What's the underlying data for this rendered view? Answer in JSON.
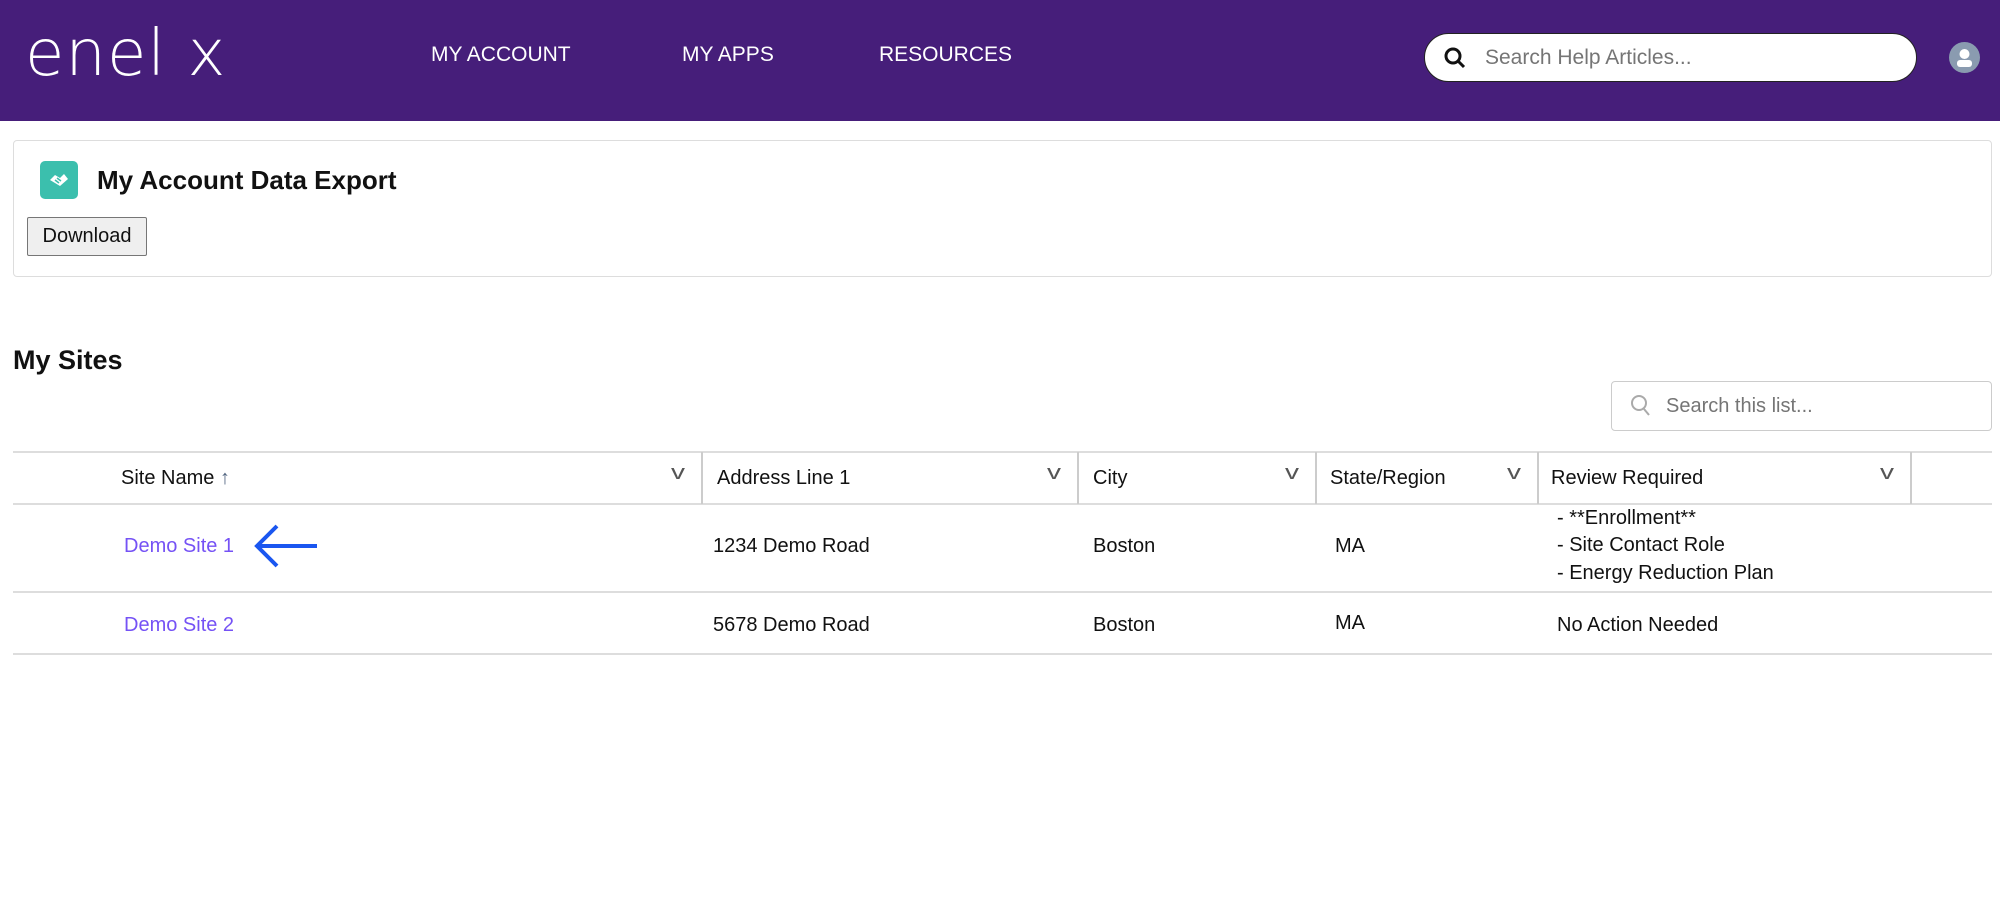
{
  "header": {
    "logo": "enel x",
    "nav": [
      "MY ACCOUNT",
      "MY APPS",
      "RESOURCES"
    ],
    "search_placeholder": "Search Help Articles..."
  },
  "export_card": {
    "title": "My Account Data Export",
    "download_label": "Download"
  },
  "sites": {
    "title": "My Sites",
    "search_placeholder": "Search this list...",
    "columns": [
      "Site Name",
      "Address Line 1",
      "City",
      "State/Region",
      "Review Required"
    ],
    "sort_indicator": "↑",
    "rows": [
      {
        "name": "Demo Site 1",
        "address": "1234 Demo Road",
        "city": "Boston",
        "state": "MA",
        "review": [
          "- **Enrollment**",
          "- Site Contact Role",
          "- Energy Reduction Plan"
        ]
      },
      {
        "name": "Demo Site 2",
        "address": "5678 Demo Road",
        "city": "Boston",
        "state": "MA",
        "review": [
          "No Action Needed"
        ]
      }
    ]
  },
  "colors": {
    "header": "#461e7a",
    "link": "#7552f5",
    "arrow": "#1a56f0",
    "icon": "#3bbfad"
  }
}
